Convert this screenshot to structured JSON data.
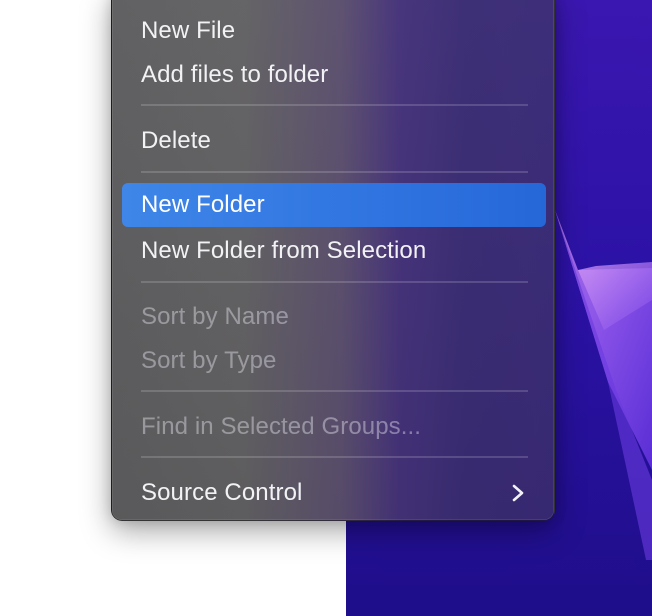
{
  "menu": {
    "items": [
      {
        "label": "New File",
        "enabled": true
      },
      {
        "label": "Add files to folder",
        "enabled": true
      },
      {
        "label": "Delete",
        "enabled": true
      },
      {
        "label": "New Folder",
        "enabled": true,
        "highlighted": true
      },
      {
        "label": "New Folder from Selection",
        "enabled": true
      },
      {
        "label": "Sort by Name",
        "enabled": false
      },
      {
        "label": "Sort by Type",
        "enabled": false
      },
      {
        "label": "Find in Selected Groups...",
        "enabled": false
      },
      {
        "label": "Source Control",
        "enabled": true,
        "submenu": true,
        "icon": "chevron-right-icon"
      }
    ]
  },
  "colors": {
    "highlight": "#2f74e0",
    "menu_text": "#f2f2f5",
    "disabled_text": "#8f8a9c",
    "wallpaper": "#2c12a6"
  }
}
